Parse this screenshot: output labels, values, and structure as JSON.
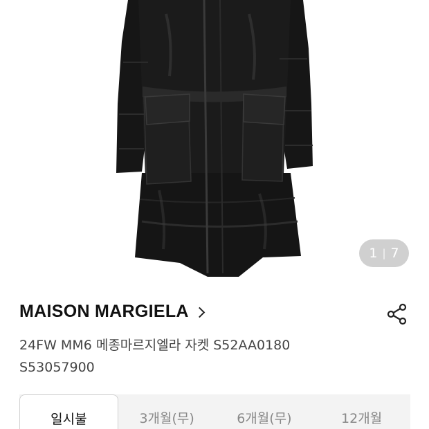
{
  "pager": {
    "current": "1",
    "separator": "|",
    "total": "7"
  },
  "product": {
    "brand": "MAISON MARGIELA",
    "name_line1": "24FW MM6 메종마르지엘라 자켓 S52AA0180",
    "name_line2": "S53057900"
  },
  "icons": {
    "brand_chevron": "chevron-right-icon",
    "share": "share-icon"
  },
  "tabs": [
    {
      "label": "일시불",
      "active": true
    },
    {
      "label": "3개월(무)",
      "active": false
    },
    {
      "label": "6개월(무)",
      "active": false
    },
    {
      "label": "12개월",
      "active": false
    }
  ],
  "colors": {
    "jacket": "#141414",
    "tab_bg": "#f3f3f3",
    "pager_bg": "#bebebe"
  }
}
